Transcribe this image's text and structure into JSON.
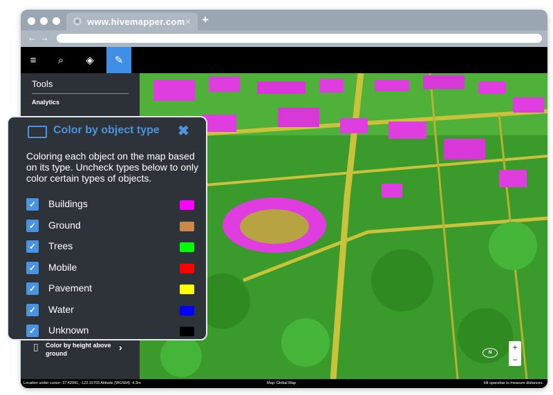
{
  "browser": {
    "tab_title": "www.hivemapper.com",
    "tab_close": "×",
    "new_tab": "+",
    "back": "←",
    "forward": "→",
    "favicon": "▣"
  },
  "toolbar": {
    "menu": "≡",
    "search": "⌕",
    "layers": "◈",
    "tools": "✎"
  },
  "sidebar": {
    "title": "Tools",
    "section": "Analytics",
    "height_item": {
      "label": "Color by height above ground",
      "arrow": "›",
      "icon": "▯"
    }
  },
  "popup": {
    "title": "Color by object type",
    "close": "✖",
    "description": "Coloring each object on the map based on its type. Uncheck types below to only color certain types of objects.",
    "check_mark": "✓",
    "types": [
      {
        "label": "Buildings",
        "color": "#ff00ff"
      },
      {
        "label": "Ground",
        "color": "#cd8848"
      },
      {
        "label": "Trees",
        "color": "#00ff00"
      },
      {
        "label": "Mobile",
        "color": "#ff0000"
      },
      {
        "label": "Pavement",
        "color": "#ffff00"
      },
      {
        "label": "Water",
        "color": "#0000ff"
      },
      {
        "label": "Unknown",
        "color": "#000000"
      }
    ]
  },
  "status": {
    "left": "Location under cursor: 37.42991, -122.15703 Altitude (WGS84) -4.3m",
    "middle": "Map: Global Map",
    "right": "Hit spacebar to measure distances."
  },
  "map_controls": {
    "zoom_in": "+",
    "zoom_out": "−",
    "compass": "N"
  },
  "colors": {
    "accent": "#4a93e0",
    "active_tool": "#3f8fe6"
  }
}
